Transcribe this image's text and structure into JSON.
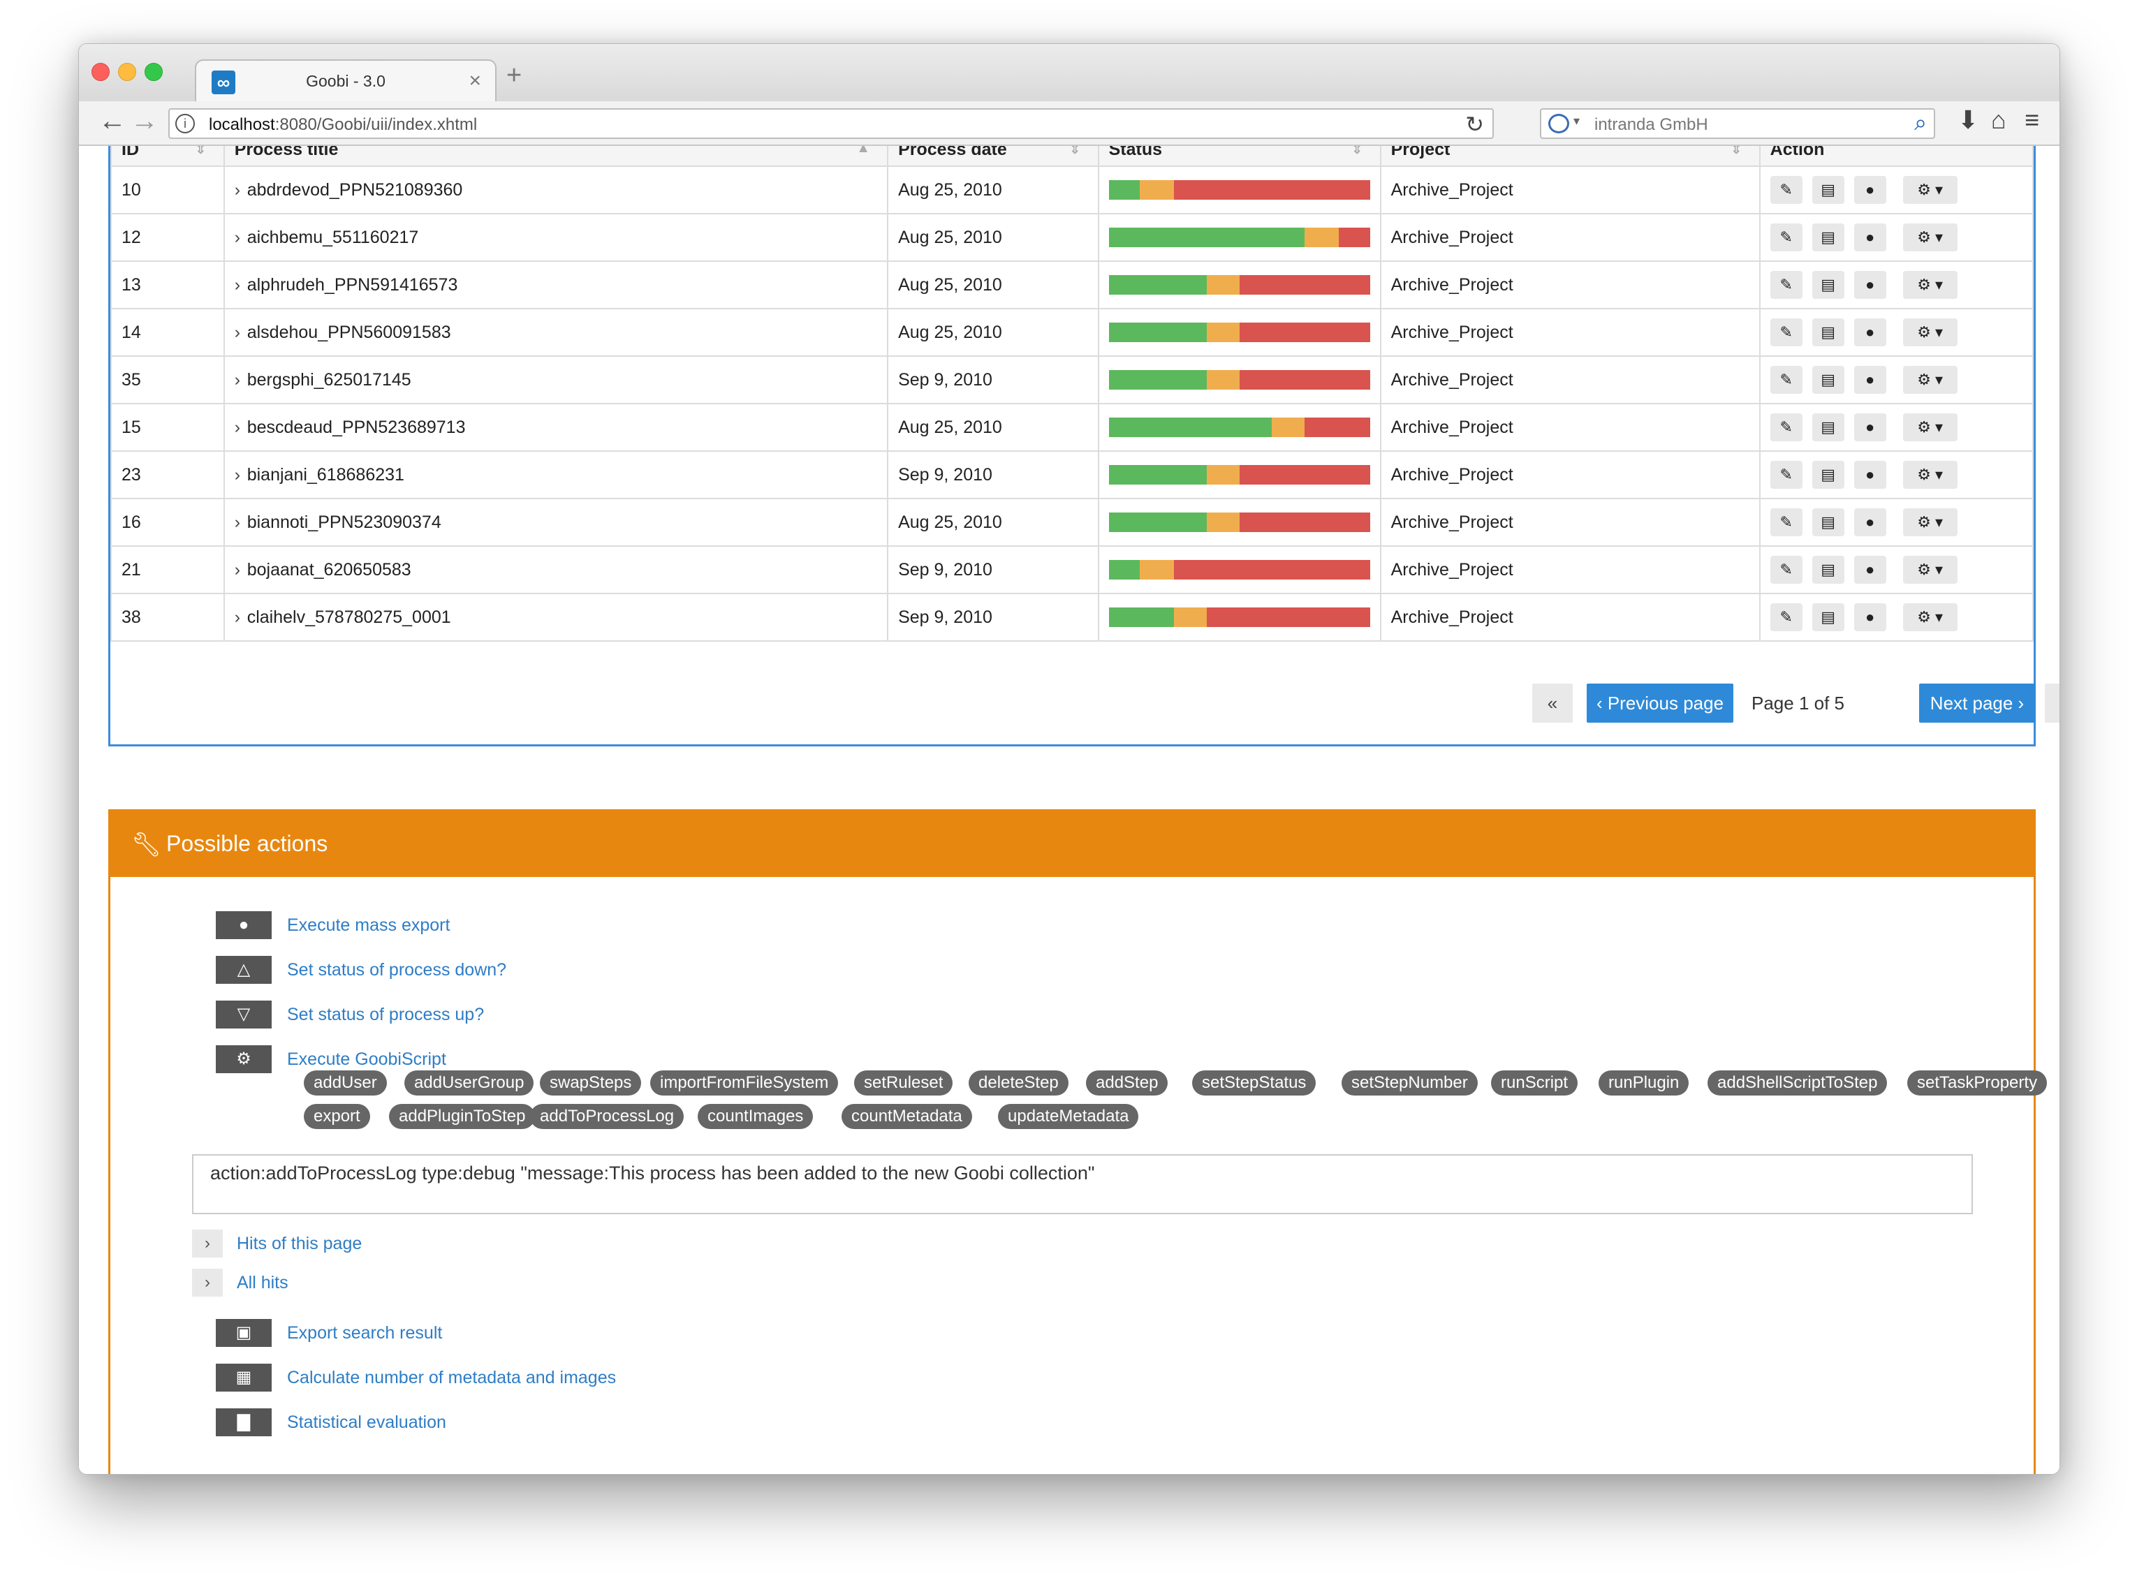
{
  "browser": {
    "tab_title": "Goobi - 3.0",
    "tab_logo": "∞",
    "url_host": "localhost",
    "url_path": ":8080/Goobi/uii/index.xhtml",
    "search_text": "intranda GmbH"
  },
  "table": {
    "headers": {
      "id": "ID",
      "title": "Process title",
      "date": "Process date",
      "status": "Status",
      "project": "Project",
      "action": "Action"
    },
    "rows": [
      {
        "id": "10",
        "title": "abdrdevod_PPN521089360",
        "date": "Aug 25, 2010",
        "project": "Archive_Project",
        "status": [
          0.12,
          0.13,
          0.75
        ]
      },
      {
        "id": "12",
        "title": "aichbemu_551160217",
        "date": "Aug 25, 2010",
        "project": "Archive_Project",
        "status": [
          0.75,
          0.13,
          0.12
        ]
      },
      {
        "id": "13",
        "title": "alphrudeh_PPN591416573",
        "date": "Aug 25, 2010",
        "project": "Archive_Project",
        "status": [
          0.375,
          0.125,
          0.5
        ]
      },
      {
        "id": "14",
        "title": "alsdehou_PPN560091583",
        "date": "Aug 25, 2010",
        "project": "Archive_Project",
        "status": [
          0.375,
          0.125,
          0.5
        ]
      },
      {
        "id": "35",
        "title": "bergsphi_625017145",
        "date": "Sep 9, 2010",
        "project": "Archive_Project",
        "status": [
          0.375,
          0.125,
          0.5
        ]
      },
      {
        "id": "15",
        "title": "bescdeaud_PPN523689713",
        "date": "Aug 25, 2010",
        "project": "Archive_Project",
        "status": [
          0.625,
          0.125,
          0.25
        ]
      },
      {
        "id": "23",
        "title": "bianjani_618686231",
        "date": "Sep 9, 2010",
        "project": "Archive_Project",
        "status": [
          0.375,
          0.125,
          0.5
        ]
      },
      {
        "id": "16",
        "title": "biannoti_PPN523090374",
        "date": "Aug 25, 2010",
        "project": "Archive_Project",
        "status": [
          0.375,
          0.125,
          0.5
        ]
      },
      {
        "id": "21",
        "title": "bojaanat_620650583",
        "date": "Sep 9, 2010",
        "project": "Archive_Project",
        "status": [
          0.12,
          0.13,
          0.75
        ]
      },
      {
        "id": "38",
        "title": "claihelv_578780275_0001",
        "date": "Sep 9, 2010",
        "project": "Archive_Project",
        "status": [
          0.25,
          0.125,
          0.625
        ]
      }
    ]
  },
  "pager": {
    "first": "«",
    "prev": "‹ Previous page",
    "info": "Page 1 of 5",
    "next": "Next page ›",
    "last": "»"
  },
  "actions": {
    "title": "Possible actions",
    "items": {
      "mass_export": "Execute mass export",
      "status_down": "Set status of process down?",
      "status_up": "Set status of process up?",
      "goobiscript": "Execute GoobiScript",
      "export_search": "Export search result",
      "calc_metadata": "Calculate number of metadata and images",
      "statistics": "Statistical evaluation"
    },
    "tags": [
      "addUser",
      "addUserGroup",
      "swapSteps",
      "importFromFileSystem",
      "setRuleset",
      "deleteStep",
      "addStep",
      "setStepStatus",
      "setStepNumber",
      "runScript",
      "runPlugin",
      "addShellScriptToStep",
      "setTaskProperty",
      "export",
      "addPluginToStep",
      "addToProcessLog",
      "countImages",
      "countMetadata",
      "updateMetadata"
    ],
    "script_value": "action:addToProcessLog type:debug \"message:This process has been added to the new Goobi collection\"",
    "hits_page": "Hits of this page",
    "hits_all": "All hits"
  },
  "colors": {
    "status_done": "#5cb85c",
    "status_open": "#f0ad4e",
    "status_locked": "#d9534f",
    "accent_blue": "#2e8ad8",
    "actions_orange": "#e8870f"
  }
}
